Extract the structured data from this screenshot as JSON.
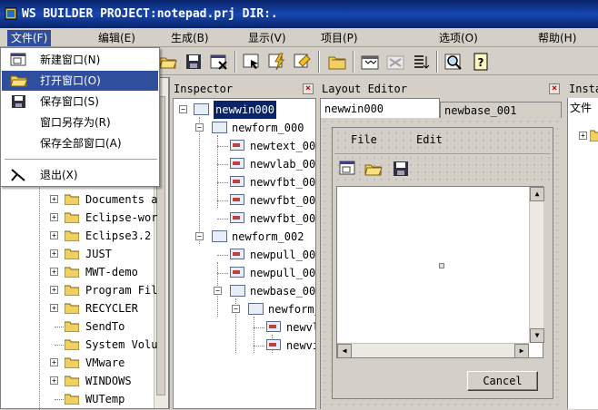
{
  "window": {
    "title": "WS BUILDER PROJECT:notepad.prj DIR:."
  },
  "menu": {
    "items": [
      {
        "label": "文件(F)"
      },
      {
        "label": "编辑(E)"
      },
      {
        "label": "生成(B)"
      },
      {
        "label": "显示(V)"
      },
      {
        "label": "项目(P)"
      },
      {
        "label": "选项(O)"
      },
      {
        "label": "帮助(H)"
      }
    ]
  },
  "file_menu": {
    "items": [
      {
        "label": "新建窗口(N)",
        "icon": "new-window-icon"
      },
      {
        "label": "打开窗口(O)",
        "icon": "open-folder-icon"
      },
      {
        "label": "保存窗口(S)",
        "icon": "save-icon"
      },
      {
        "label": "窗口另存为(R)"
      },
      {
        "label": "保存全部窗口(A)"
      },
      {
        "label": "退出(X)",
        "icon": "exit-icon"
      }
    ]
  },
  "left_tree": {
    "items": [
      {
        "label": "Documents a"
      },
      {
        "label": "Eclipse-wor"
      },
      {
        "label": "Eclipse3.2"
      },
      {
        "label": "JUST"
      },
      {
        "label": "MWT-demo"
      },
      {
        "label": "Program Fil"
      },
      {
        "label": "RECYCLER"
      },
      {
        "label": "SendTo"
      },
      {
        "label": "System Volu"
      },
      {
        "label": "VMware"
      },
      {
        "label": "WINDOWS"
      },
      {
        "label": "WUTemp"
      }
    ]
  },
  "inspector": {
    "title": "Inspector",
    "nodes": [
      {
        "label": "newwin000"
      },
      {
        "label": "newform_000"
      },
      {
        "label": "newtext_00"
      },
      {
        "label": "newvlab_00"
      },
      {
        "label": "newvfbt_00"
      },
      {
        "label": "newvfbt_00"
      },
      {
        "label": "newvfbt_00"
      },
      {
        "label": "newform_002"
      },
      {
        "label": "newpull_00"
      },
      {
        "label": "newpull_00"
      },
      {
        "label": "newbase_00"
      },
      {
        "label": "newform_"
      },
      {
        "label": "newvl"
      },
      {
        "label": "newvi"
      }
    ]
  },
  "layout_editor": {
    "title": "Layout Editor",
    "tabs": [
      {
        "label": "newwin000"
      },
      {
        "label": "newbase_001"
      }
    ],
    "form_menu": {
      "file": "File",
      "edit": "Edit"
    },
    "cancel_label": "Cancel"
  },
  "right_panel": {
    "title": "Insta",
    "tab": "文件"
  }
}
